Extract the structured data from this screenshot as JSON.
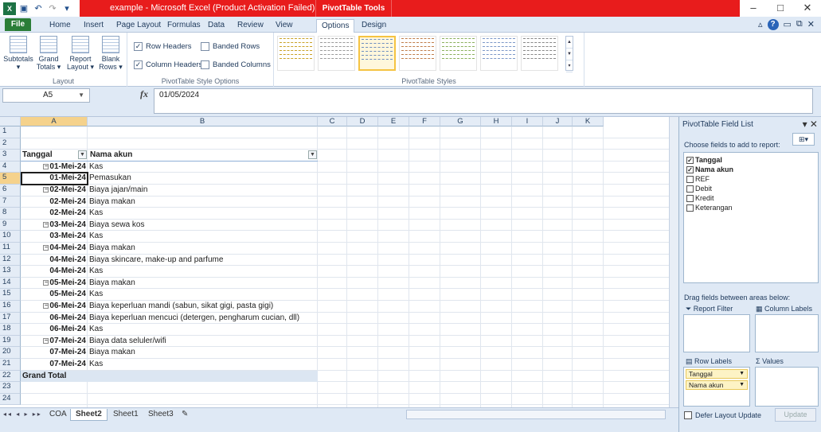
{
  "window": {
    "title": "example - Microsoft Excel (Product Activation Failed)",
    "context_tab": "PivotTable Tools",
    "controls": [
      "–",
      "□",
      "✕"
    ]
  },
  "ribbon_tabs": [
    "File",
    "Home",
    "Insert",
    "Page Layout",
    "Formulas",
    "Data",
    "Review",
    "View",
    "Options",
    "Design"
  ],
  "ribbon": {
    "layout": {
      "label": "Layout",
      "buttons": [
        "Subtotals",
        "Grand Totals",
        "Report Layout",
        "Blank Rows"
      ]
    },
    "style_options": {
      "label": "PivotTable Style Options",
      "row_headers": "Row Headers",
      "column_headers": "Column Headers",
      "banded_rows": "Banded Rows",
      "banded_columns": "Banded Columns"
    },
    "styles": {
      "label": "PivotTable Styles",
      "swatch_colors": [
        "#c9a227",
        "#9a9a9a",
        "#6c8ebf",
        "#c07d4a",
        "#8bb05c",
        "#7c98c8",
        "#888888"
      ]
    }
  },
  "formula_bar": {
    "name_box": "A5",
    "fx": "fx",
    "formula": "01/05/2024"
  },
  "columns": [
    "A",
    "B",
    "C",
    "D",
    "E",
    "F",
    "G",
    "H",
    "I",
    "J",
    "K"
  ],
  "rows": [
    "1",
    "2",
    "3",
    "4",
    "5",
    "6",
    "7",
    "8",
    "9",
    "10",
    "11",
    "12",
    "13",
    "14",
    "15",
    "16",
    "17",
    "18",
    "19",
    "20",
    "21",
    "22",
    "23",
    "24"
  ],
  "pivot": {
    "header_a": "Tanggal",
    "header_b": "Nama akun",
    "grand_total": "Grand Total",
    "lines": [
      {
        "row": 4,
        "date": "01-Mei-24",
        "name": "Kas",
        "group": true
      },
      {
        "row": 5,
        "date": "01-Mei-24",
        "name": "Pemasukan",
        "group": false
      },
      {
        "row": 6,
        "date": "02-Mei-24",
        "name": "Biaya jajan/main",
        "group": true
      },
      {
        "row": 7,
        "date": "02-Mei-24",
        "name": "Biaya makan",
        "group": false
      },
      {
        "row": 8,
        "date": "02-Mei-24",
        "name": "Kas",
        "group": false
      },
      {
        "row": 9,
        "date": "03-Mei-24",
        "name": "Biaya sewa kos",
        "group": true
      },
      {
        "row": 10,
        "date": "03-Mei-24",
        "name": "Kas",
        "group": false
      },
      {
        "row": 11,
        "date": "04-Mei-24",
        "name": "Biaya makan",
        "group": true
      },
      {
        "row": 12,
        "date": "04-Mei-24",
        "name": "Biaya skincare, make-up and parfume",
        "group": false
      },
      {
        "row": 13,
        "date": "04-Mei-24",
        "name": "Kas",
        "group": false
      },
      {
        "row": 14,
        "date": "05-Mei-24",
        "name": "Biaya makan",
        "group": true
      },
      {
        "row": 15,
        "date": "05-Mei-24",
        "name": "Kas",
        "group": false
      },
      {
        "row": 16,
        "date": "06-Mei-24",
        "name": "Biaya keperluan mandi (sabun, sikat gigi, pasta gigi)",
        "group": true
      },
      {
        "row": 17,
        "date": "06-Mei-24",
        "name": "Biaya keperluan mencuci (detergen, pengharum cucian, dll)",
        "group": false
      },
      {
        "row": 18,
        "date": "06-Mei-24",
        "name": "Kas",
        "group": false
      },
      {
        "row": 19,
        "date": "07-Mei-24",
        "name": "Biaya data seluler/wifi",
        "group": true
      },
      {
        "row": 20,
        "date": "07-Mei-24",
        "name": "Biaya makan",
        "group": false
      },
      {
        "row": 21,
        "date": "07-Mei-24",
        "name": "Kas",
        "group": false
      }
    ]
  },
  "sheet_tabs": [
    "COA",
    "Sheet2",
    "Sheet1",
    "Sheet3"
  ],
  "active_sheet": "Sheet2",
  "field_list": {
    "title": "PivotTable Field List",
    "choose_label": "Choose fields to add to report:",
    "fields": [
      {
        "name": "Tanggal",
        "checked": true
      },
      {
        "name": "Nama akun",
        "checked": true
      },
      {
        "name": "REF",
        "checked": false
      },
      {
        "name": "Debit",
        "checked": false
      },
      {
        "name": "Kredit",
        "checked": false
      },
      {
        "name": "Keterangan",
        "checked": false
      }
    ],
    "drag_label": "Drag fields between areas below:",
    "report_filter": "Report Filter",
    "column_labels": "Column Labels",
    "row_labels": "Row Labels",
    "values": "Values",
    "row_chips": [
      "Tanggal",
      "Nama akun"
    ],
    "defer_label": "Defer Layout Update",
    "update_label": "Update"
  }
}
